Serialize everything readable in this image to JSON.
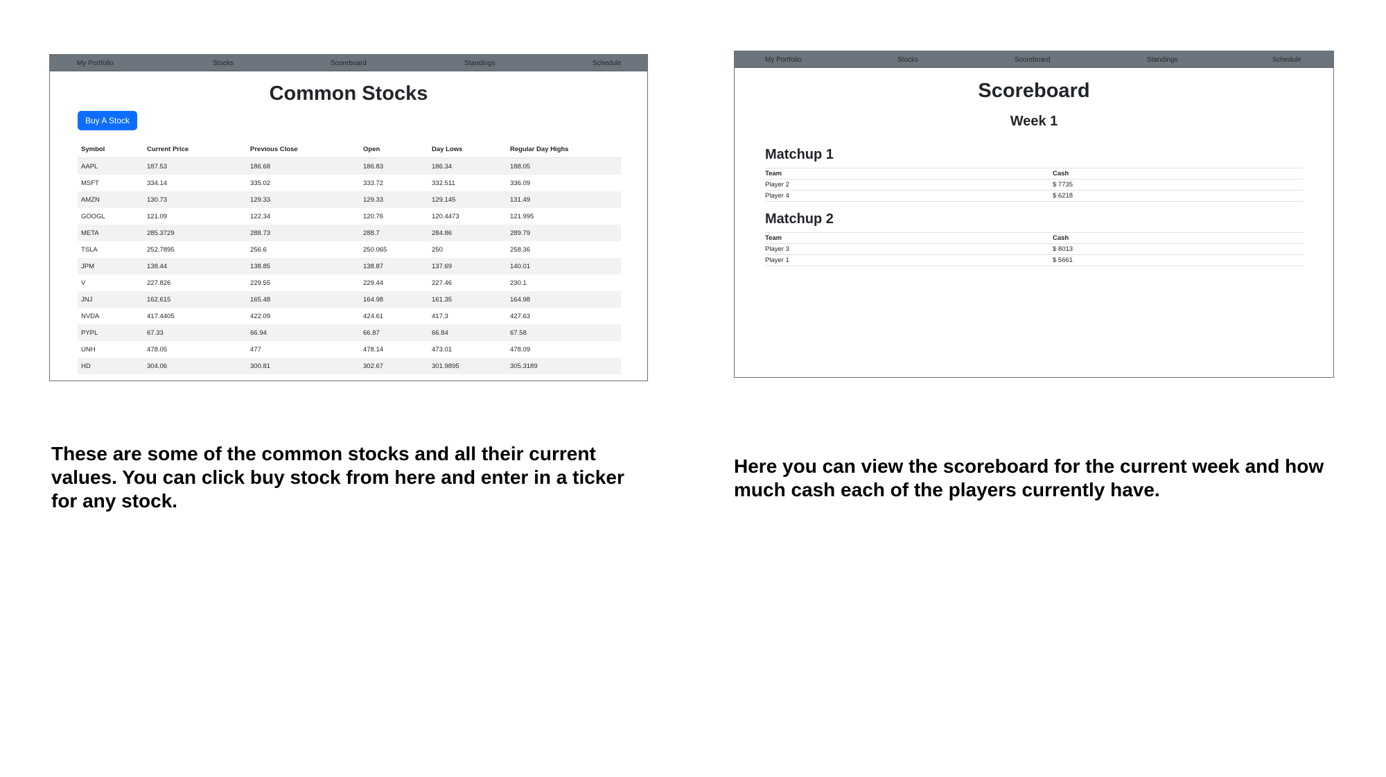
{
  "nav": [
    "My Portfolio",
    "Stocks",
    "Scoreboard",
    "Standings",
    "Schedule"
  ],
  "stocks_page": {
    "title": "Common Stocks",
    "buy_button": "Buy A Stock",
    "headers": [
      "Symbol",
      "Current Price",
      "Previous Close",
      "Open",
      "Day Lows",
      "Regular Day Highs"
    ],
    "rows": [
      [
        "AAPL",
        "187.53",
        "186.68",
        "186.83",
        "186.34",
        "188.05"
      ],
      [
        "MSFT",
        "334.14",
        "335.02",
        "333.72",
        "332.511",
        "336.09"
      ],
      [
        "AMZN",
        "130.73",
        "129.33",
        "129.33",
        "129.145",
        "131.49"
      ],
      [
        "GOOGL",
        "121.09",
        "122.34",
        "120.76",
        "120.4473",
        "121.995"
      ],
      [
        "META",
        "285.3729",
        "288.73",
        "288.7",
        "284.86",
        "289.79"
      ],
      [
        "TSLA",
        "252.7895",
        "256.6",
        "250.065",
        "250",
        "258.36"
      ],
      [
        "JPM",
        "138.44",
        "138.85",
        "138.87",
        "137.69",
        "140.01"
      ],
      [
        "V",
        "227.826",
        "229.55",
        "229.44",
        "227.46",
        "230.1"
      ],
      [
        "JNJ",
        "162.615",
        "165.48",
        "164.98",
        "161.35",
        "164.98"
      ],
      [
        "NVDA",
        "417.4405",
        "422.09",
        "424.61",
        "417.3",
        "427.63"
      ],
      [
        "PYPL",
        "67.33",
        "66.94",
        "66.87",
        "66.84",
        "67.58"
      ],
      [
        "UNH",
        "478.05",
        "477",
        "478.14",
        "473.01",
        "478.09"
      ],
      [
        "HD",
        "304.06",
        "300.81",
        "302.67",
        "301.9895",
        "305.3189"
      ]
    ]
  },
  "scoreboard_page": {
    "title": "Scoreboard",
    "week": "Week 1",
    "matchups": [
      {
        "title": "Matchup 1",
        "headers": [
          "Team",
          "Cash"
        ],
        "rows": [
          [
            "Player 2",
            "$ 7735"
          ],
          [
            "Player 4",
            "$ 6218"
          ]
        ]
      },
      {
        "title": "Matchup 2",
        "headers": [
          "Team",
          "Cash"
        ],
        "rows": [
          [
            "Player 3",
            "$ 8013"
          ],
          [
            "Player 1",
            "$ 5661"
          ]
        ]
      }
    ]
  },
  "captions": {
    "left": "These are some of the common stocks and all their current values. You can click buy stock from here and enter in a ticker for any stock.",
    "right": "Here you can view the scoreboard for the current week and how much cash each of the players currently have."
  }
}
